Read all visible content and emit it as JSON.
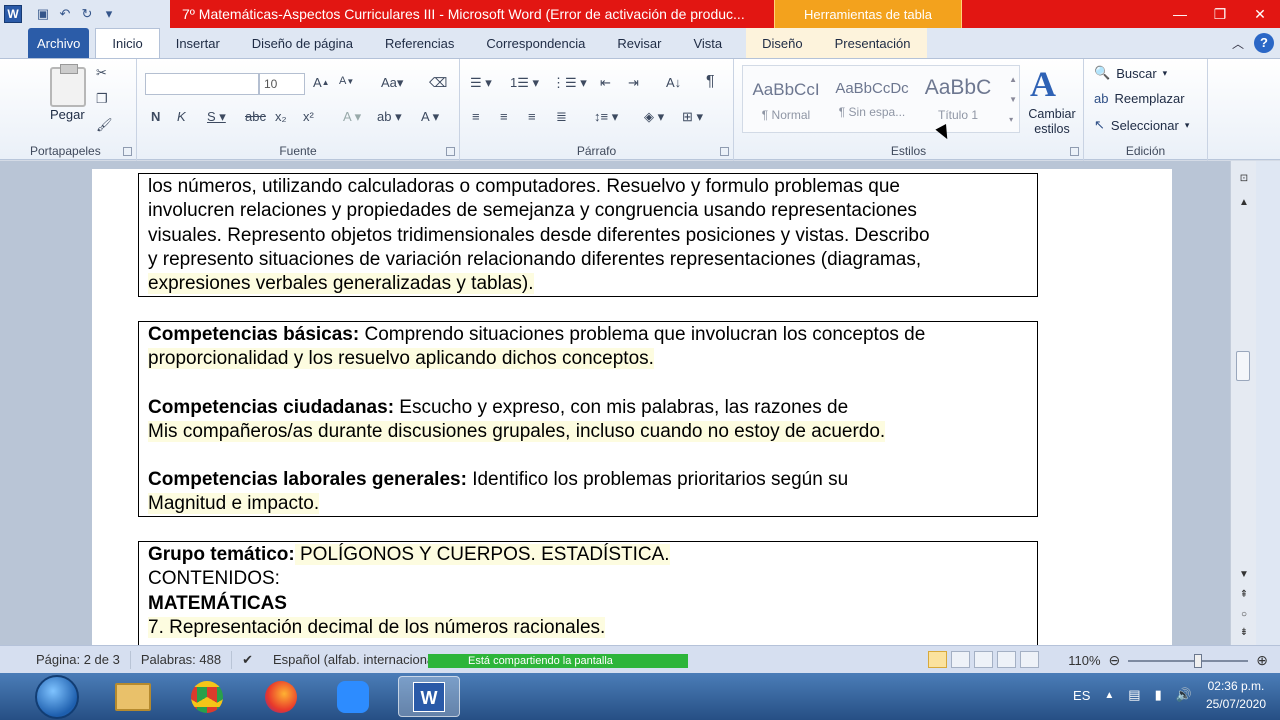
{
  "window": {
    "title": "7º Matemáticas-Aspectos Curriculares III  -  Microsoft Word (Error de activación de produc...",
    "context_tab_header": "Herramientas de tabla"
  },
  "tabs": [
    "Archivo",
    "Inicio",
    "Insertar",
    "Diseño de página",
    "Referencias",
    "Correspondencia",
    "Revisar",
    "Vista",
    "Diseño",
    "Presentación"
  ],
  "ribbon": {
    "clipboard": {
      "paste": "Pegar",
      "label": "Portapapeles"
    },
    "font": {
      "size": "10",
      "label": "Fuente"
    },
    "paragraph": {
      "label": "Párrafo"
    },
    "styles": {
      "label": "Estilos",
      "items": [
        {
          "sample": "AaBbCcI",
          "name": "¶ Normal"
        },
        {
          "sample": "AaBbCcDc",
          "name": "¶ Sin espa..."
        },
        {
          "sample": "AaBbC",
          "name": "Título 1"
        }
      ],
      "change": "Cambiar estilos"
    },
    "editing": {
      "label": "Edición",
      "find": "Buscar",
      "replace": "Reemplazar",
      "select": "Seleccionar"
    }
  },
  "document": {
    "box1_lines": [
      "los números, utilizando calculadoras o computadores. Resuelvo y formulo problemas que",
      "involucren relaciones y propiedades de semejanza y congruencia usando representaciones",
      "visuales. Represento objetos tridimensionales desde diferentes posiciones y vistas. Describo",
      "y represento situaciones de variación relacionando diferentes representaciones (diagramas,",
      "expresiones verbales generalizadas y tablas)."
    ],
    "box2": {
      "basicas_label": "Competencias básicas:",
      "basicas_text": " Comprendo situaciones problema que involucran los conceptos de",
      "basicas_text2": "proporcionalidad y los resuelvo aplicando dichos conceptos.",
      "ciudadanas_label": "Competencias ciudadanas:",
      "ciudadanas_text": " Escucho y expreso, con mis palabras, las razones de",
      "ciudadanas_text2": "Mis compañeros/as durante discusiones grupales, incluso cuando no estoy de acuerdo.",
      "laborales_label": "Competencias laborales generales:",
      "laborales_text": " Identifico los problemas prioritarios según su",
      "laborales_text2": "Magnitud e impacto."
    },
    "box3": {
      "grupo_label": "Grupo temático:",
      "grupo_text": " POLÍGONOS Y CUERPOS. ESTADÍSTICA.",
      "contenidos": "CONTENIDOS:",
      "matematicas": "MATEMÁTICAS",
      "item7": "7. Representación decimal de los números racionales."
    }
  },
  "statusbar": {
    "page": "Página: 2 de 3",
    "words": "Palabras: 488",
    "language": "Español (alfab. internacional)",
    "share": "Está compartiendo la pantalla",
    "zoom": "110%"
  },
  "taskbar": {
    "lang": "ES",
    "time": "02:36 p.m.",
    "date": "25/07/2020"
  }
}
